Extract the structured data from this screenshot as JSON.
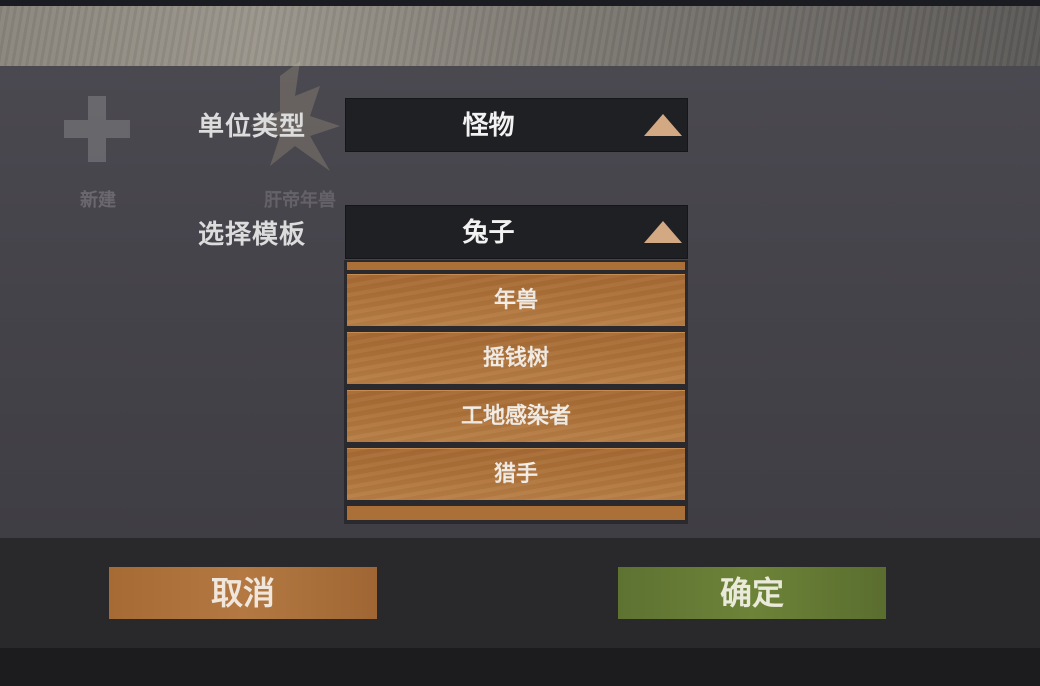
{
  "background_tiles": {
    "new_label": "新建",
    "nian_label": "肝帝年兽"
  },
  "form": {
    "unit_type_label": "单位类型",
    "unit_type_value": "怪物",
    "template_label": "选择模板",
    "template_value": "兔子"
  },
  "template_options": [
    "年兽",
    "摇钱树",
    "工地感染者",
    "猎手"
  ],
  "buttons": {
    "cancel": "取消",
    "confirm": "确定"
  },
  "colors": {
    "wood_button": "#a76a34",
    "confirm_green": "#6d8338",
    "arrow": "#d3a984",
    "dropdown_bg": "#1f2024"
  }
}
